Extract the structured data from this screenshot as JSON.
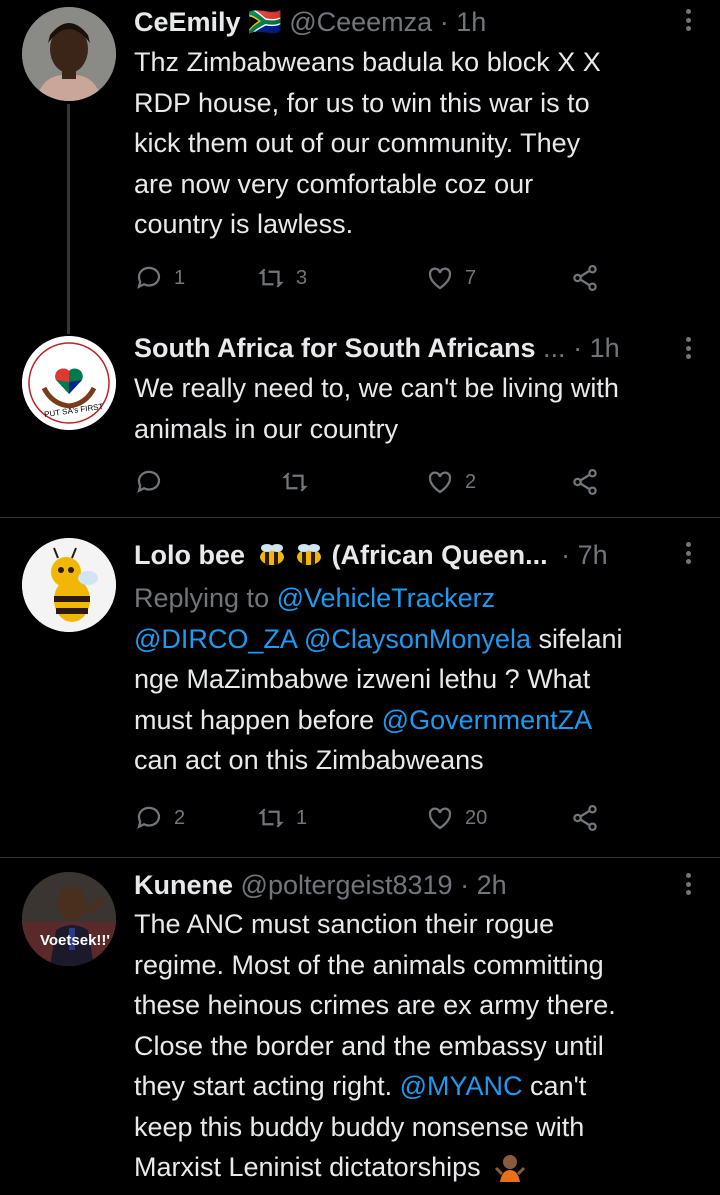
{
  "tweets": [
    {
      "name": "CeEmily",
      "flag": "🇿🇦",
      "handle": "@Ceeemza",
      "time": "· 1h",
      "lines": [
        "Thz Zimbabweans badula ko block X X",
        "RDP house, for us to win this war is to",
        "kick them out of our community. They",
        "are now very comfortable coz our",
        "country is lawless."
      ],
      "replies": "1",
      "retweets": "3",
      "likes": "7"
    },
    {
      "name": "South Africa for South Africans",
      "handle": "...",
      "time": "· 1h",
      "lines": [
        "We really need to, we can't be living with",
        "animals in our country"
      ],
      "replies": "",
      "retweets": "",
      "likes": "2",
      "avatar_text": "PUT SA's FIRST"
    },
    {
      "name": "Lolo bee",
      "name_suffix": "(African Queen...",
      "time": "· 7h",
      "replying_prefix": "Replying to",
      "replying_to": "@VehicleTrackerz",
      "mention1": "@DIRCO_ZA",
      "mention2": "@ClaysonMonyela",
      "line1_rest": " sifelani",
      "line2": "nge MaZimbabwe izweni lethu ? What",
      "line3_pre": "must happen before ",
      "mention3": "@GovernmentZA",
      "line4": "can act on this Zimbabweans",
      "replies": "2",
      "retweets": "1",
      "likes": "20"
    },
    {
      "name": "Kunene",
      "handle": "@poltergeist8319",
      "time": "· 2h",
      "avatar_text": "Voetsek!!'",
      "line1": "The ANC must sanction their rogue",
      "line2": "regime. Most of the animals committing",
      "line3": "these heinous crimes are ex army there.",
      "line4": "Close the border and the embassy until",
      "line5_pre": "they start acting right. ",
      "mention": "@MYANC",
      "line5_post": " can't",
      "line6": "keep this buddy buddy nonsense with",
      "line7": "Marxist Leninist dictatorships"
    }
  ],
  "colors": {
    "background": "#000000",
    "text": "#e7e9ea",
    "muted": "#71767b",
    "link": "#1d9bf0",
    "divider": "#2f3336"
  }
}
